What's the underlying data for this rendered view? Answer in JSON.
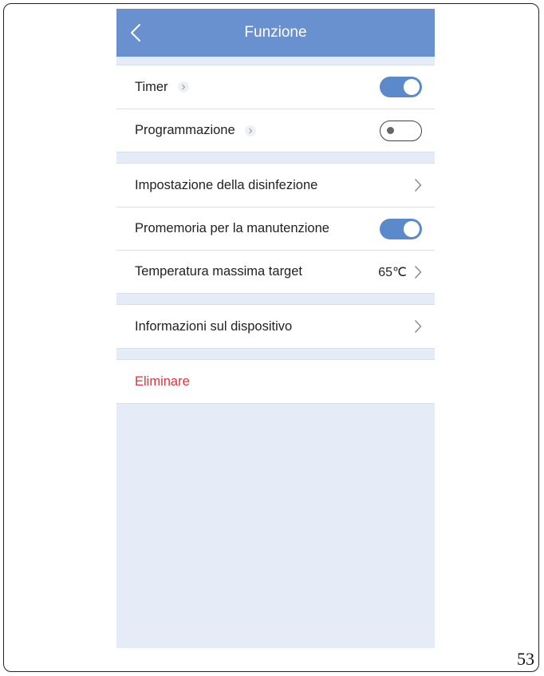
{
  "header": {
    "title": "Funzione"
  },
  "section1": {
    "timer": {
      "label": "Timer",
      "enabled": true
    },
    "programmazione": {
      "label": "Programmazione",
      "enabled": false
    }
  },
  "section2": {
    "disinfezione": {
      "label": "Impostazione della disinfezione"
    },
    "manutenzione": {
      "label": "Promemoria per la manutenzione",
      "enabled": true
    },
    "temperatura": {
      "label": "Temperatura massima target",
      "value": "65℃"
    }
  },
  "section3": {
    "dispositivo": {
      "label": "Informazioni sul dispositivo"
    }
  },
  "section4": {
    "eliminare": {
      "label": "Eliminare"
    }
  },
  "colors": {
    "header": "#6a91cf",
    "toggle_on": "#5b8acb",
    "danger": "#e5323b",
    "background": "#e5ecf7"
  },
  "page_number": "53"
}
